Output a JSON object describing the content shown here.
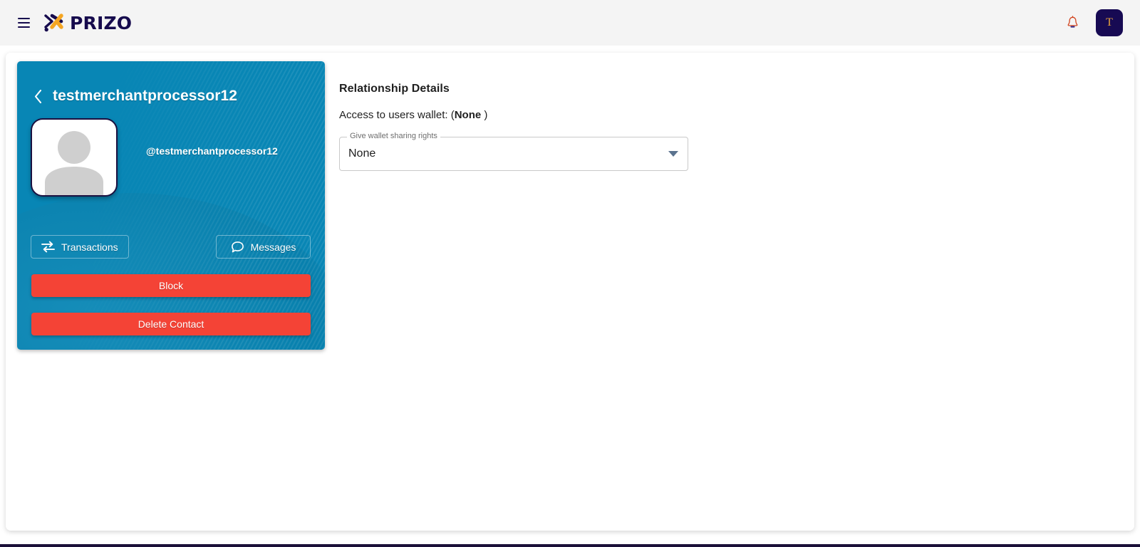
{
  "topbar": {
    "menu_icon": "hamburger-menu-icon",
    "brand_mark_icon": "prizo-x-logo-icon",
    "brand_name": "PRIZO",
    "notifications_icon": "bell-icon",
    "avatar_initial": "T",
    "colors": {
      "brand_navy": "#160a4d",
      "brand_orange": "#f5a623",
      "bar_background": "#f4f4f4",
      "avatar_background": "#170a53",
      "avatar_text": "#e6a23c"
    }
  },
  "profile_card": {
    "back_icon": "chevron-left-icon",
    "title": "testmerchantprocessor12",
    "avatar_icon": "user-placeholder-avatar-icon",
    "handle": "@testmerchantprocessor12",
    "actions": [
      {
        "label": "Transactions",
        "icon": "swap-arrows-icon"
      },
      {
        "label": "Messages",
        "icon": "chat-bubble-icon"
      }
    ],
    "block_label": "Block",
    "delete_label": "Delete Contact",
    "colors": {
      "card_background": "#0886b5",
      "danger": "#f44336",
      "avatar_border": "#1b1040"
    }
  },
  "details": {
    "heading": "Relationship Details",
    "access_label": "Access to users wallet: (",
    "access_value": "None",
    "access_suffix": " )",
    "select": {
      "label": "Give wallet sharing rights",
      "value": "None",
      "arrow_icon": "chevron-down-icon",
      "options": [
        "None"
      ]
    }
  }
}
